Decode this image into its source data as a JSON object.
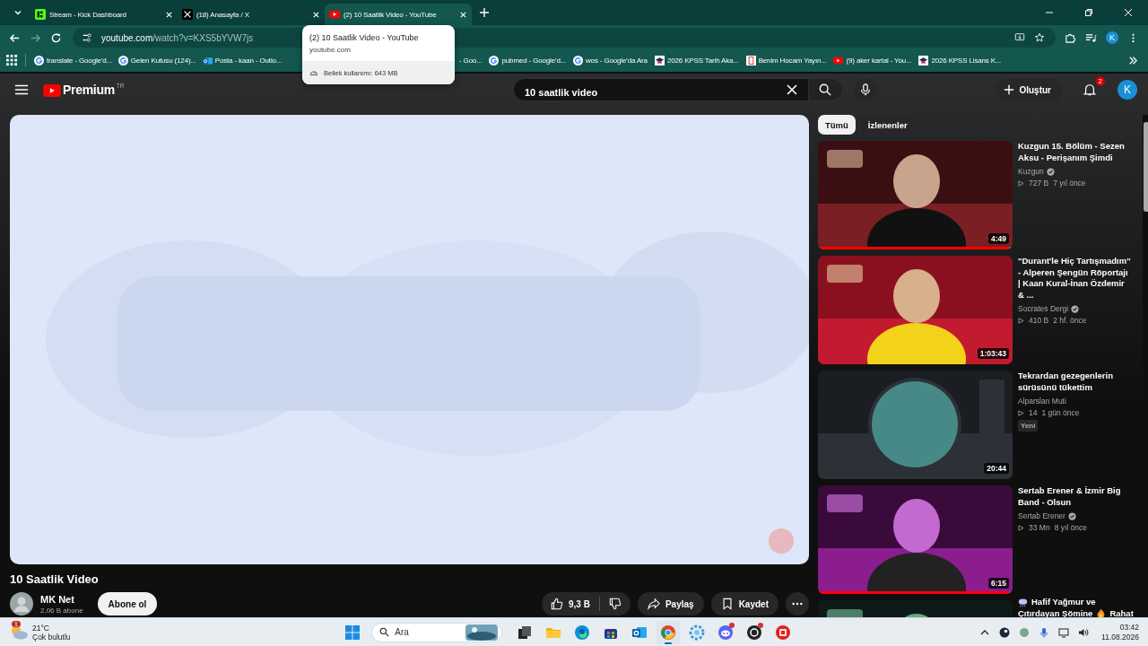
{
  "browser": {
    "tabs": [
      {
        "title": "Stream - Kick Dashboard",
        "kind": "kick",
        "selected": false
      },
      {
        "title": "(18) Anasayfa / X",
        "kind": "x",
        "selected": false
      },
      {
        "title": "(2) 10 Saatlik Video - YouTube",
        "kind": "youtube",
        "selected": true
      }
    ],
    "tab_tooltip": {
      "title": "(2) 10 Saatlik Video - YouTube",
      "domain": "youtube.com",
      "memory": "Bellek kullanımı: 643 MB"
    },
    "address": {
      "host": "youtube.com",
      "path": "/watch?v=KXS5bYVW7js"
    },
    "profile": "K",
    "bookmarks": [
      {
        "label": "translate - Google'd...",
        "kind": "google"
      },
      {
        "label": "Gelen Kutusu (124)...",
        "kind": "google"
      },
      {
        "label": "Posta - kaan - Outlo...",
        "kind": "outlook"
      },
      {
        "label": "- Goo...",
        "kind": "partial"
      },
      {
        "label": "pubmed - Google'd...",
        "kind": "google"
      },
      {
        "label": "wos - Google'da Ara",
        "kind": "google"
      },
      {
        "label": "2026 KPSS Tarih Aka...",
        "kind": "cap"
      },
      {
        "label": "Benim Hocam Yayın...",
        "kind": "book"
      },
      {
        "label": "(9) aker kartal - You...",
        "kind": "youtube"
      },
      {
        "label": "2026 KPSS Lisans K...",
        "kind": "cap"
      }
    ]
  },
  "youtube": {
    "logo": "Premium",
    "region": "TR",
    "search": {
      "value": "10 saatlik video"
    },
    "create": "Oluştur",
    "notifications": "2",
    "avatar": "K",
    "chips": [
      {
        "label": "Tümü",
        "selected": true
      },
      {
        "label": "İzlenenler",
        "selected": false
      }
    ],
    "video": {
      "kind": "picture",
      "title": "10 Saatlik Video",
      "channel": "MK Net",
      "subscribers": "2,06 B abone",
      "subscribe": "Abone ol",
      "likes": "9,3 B",
      "share": "Paylaş",
      "save": "Kaydet"
    },
    "recommendations": [
      {
        "title": "Kuzgun 15. Bölüm - Sezen Aksu - Perişanım Şimdi",
        "channel": "Kuzgun",
        "verified": true,
        "views": "727 B",
        "age": "7 yıl önce",
        "duration": "4:49",
        "progress": {
          "level": 0.98
        }
      },
      {
        "title": "\"Durant'le Hiç Tartışmadım\" - Alperen Şengün Röportajı | Kaan Kural-İnan Özdemir & ...",
        "channel": "Socrates Dergi",
        "verified": true,
        "views": "410 B",
        "age": "2 hf. önce",
        "duration": "1:03:43"
      },
      {
        "title": "Tekrardan gezegenlerin sürüsünü tükettim",
        "channel": "Alparslan Muti",
        "verified": false,
        "views": "14",
        "age": "1 gün önce",
        "badge": "Yeni",
        "duration": "20:44"
      },
      {
        "title": "Sertab Erener & İzmir Big Band - Olsun",
        "channel": "Sertab Erener",
        "verified": true,
        "views": "33 Mn",
        "age": "8 yıl önce",
        "duration": "6:15",
        "progress": {
          "level": 0.98
        }
      },
      {
        "title_parts": [
          "Hafif Yağmur ve",
          "Çıtırdayan Şömine",
          "Rahat"
        ]
      }
    ]
  },
  "taskbar": {
    "weather": {
      "badge": "1",
      "temp": "21°C",
      "desc": "Çok bulutlu"
    },
    "search": "Ara",
    "apps": [
      {
        "kind": "taskview",
        "active": false,
        "alert": false
      },
      {
        "kind": "folder",
        "active": false,
        "alert": false
      },
      {
        "kind": "edge",
        "active": false,
        "alert": false
      },
      {
        "kind": "store",
        "active": false,
        "alert": false
      },
      {
        "kind": "outlook",
        "active": false,
        "alert": false
      },
      {
        "kind": "chrome",
        "active": true,
        "alert": false
      },
      {
        "kind": "gear",
        "active": false,
        "alert": false
      },
      {
        "kind": "discord",
        "active": false,
        "alert": true
      },
      {
        "kind": "dark",
        "active": false,
        "alert": true
      },
      {
        "kind": "red",
        "active": false,
        "alert": false
      }
    ],
    "time": "03:42",
    "date": "11.08.2026"
  }
}
